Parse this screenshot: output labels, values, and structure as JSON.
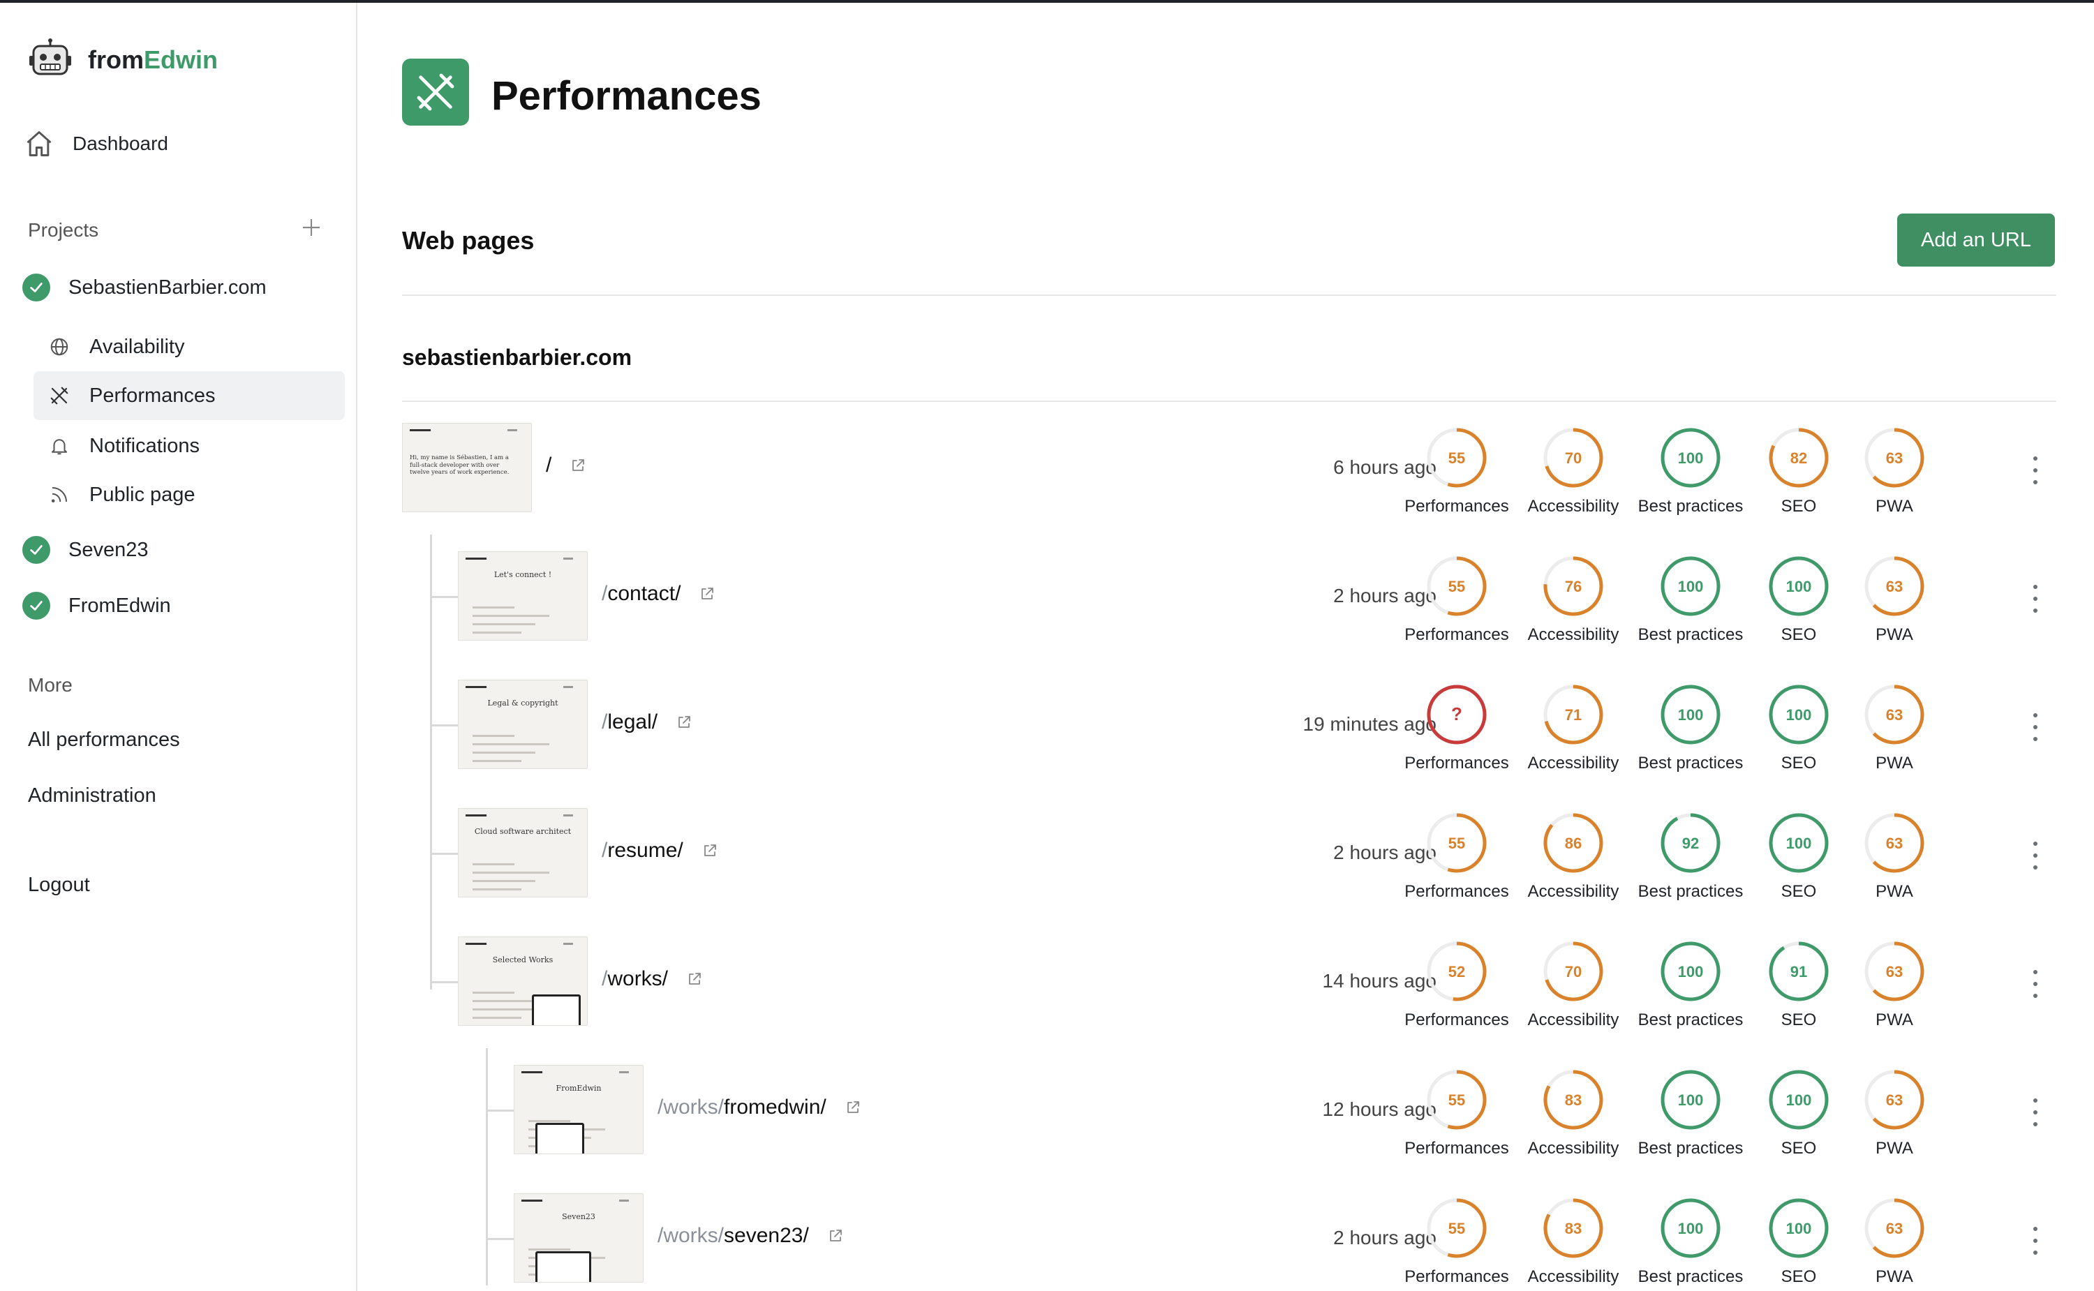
{
  "brand": {
    "prefix": "from",
    "accent": "Edwin"
  },
  "sidebar": {
    "dashboard": "Dashboard",
    "projects_label": "Projects",
    "projects": [
      {
        "name": "SebastienBarbier.com"
      },
      {
        "name": "Seven23"
      },
      {
        "name": "FromEdwin"
      }
    ],
    "subnav": [
      {
        "label": "Availability",
        "icon": "globe-icon"
      },
      {
        "label": "Performances",
        "icon": "tools-icon",
        "active": true
      },
      {
        "label": "Notifications",
        "icon": "bell-icon"
      },
      {
        "label": "Public page",
        "icon": "rss-icon"
      }
    ],
    "more_label": "More",
    "all_performances": "All performances",
    "administration": "Administration",
    "logout": "Logout"
  },
  "header": {
    "title": "Performances"
  },
  "section": {
    "title": "Web pages",
    "add_button": "Add an URL",
    "domain": "sebastienbarbier.com"
  },
  "metric_labels": [
    "Performances",
    "Accessibility",
    "Best practices",
    "SEO",
    "PWA"
  ],
  "colors": {
    "green": "#3f9a6a",
    "orange": "#d9822b",
    "red": "#c93b3b",
    "track": "#ececec"
  },
  "rows": [
    {
      "prefix": "",
      "segment": "/",
      "time": "6 hours ago",
      "scores": [
        "55",
        "70",
        "100",
        "82",
        "63"
      ]
    },
    {
      "prefix": "/ ",
      "segment": "contact/",
      "time": "2 hours ago",
      "scores": [
        "55",
        "76",
        "100",
        "100",
        "63"
      ]
    },
    {
      "prefix": "/ ",
      "segment": "legal/",
      "time": "19 minutes ago",
      "scores": [
        "?",
        "71",
        "100",
        "100",
        "63"
      ]
    },
    {
      "prefix": "/ ",
      "segment": "resume/",
      "time": "2 hours ago",
      "scores": [
        "55",
        "86",
        "92",
        "100",
        "63"
      ]
    },
    {
      "prefix": "/ ",
      "segment": "works/",
      "time": "14 hours ago",
      "scores": [
        "52",
        "70",
        "100",
        "91",
        "63"
      ]
    },
    {
      "prefix": "/works/ ",
      "segment": "fromedwin/",
      "time": "12 hours ago",
      "scores": [
        "55",
        "83",
        "100",
        "100",
        "63"
      ]
    },
    {
      "prefix": "/works/ ",
      "segment": "seven23/",
      "time": "2 hours ago",
      "scores": [
        "55",
        "83",
        "100",
        "100",
        "63"
      ]
    }
  ],
  "thumbnails": [
    {
      "heading": "Hi, my name is Sébastien, I am a full-stack developer with over twelve years of work experience."
    },
    {
      "heading": "Let's connect !"
    },
    {
      "heading": "Legal & copyright"
    },
    {
      "heading": "Cloud software architect"
    },
    {
      "heading": "Selected Works"
    },
    {
      "heading": "FromEdwin"
    },
    {
      "heading": "Seven23"
    }
  ]
}
